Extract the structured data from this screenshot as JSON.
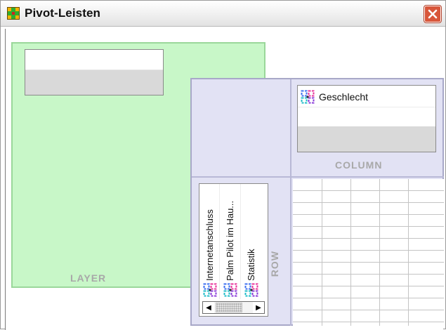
{
  "window": {
    "title": "Pivot-Leisten",
    "title_icon": "pivot-trays-icon",
    "close_icon": "close-x-icon"
  },
  "layer": {
    "label": "LAYER",
    "color": "#c8f7c8"
  },
  "column": {
    "label": "COLUMN",
    "items": [
      {
        "label": "Geschlecht",
        "icon": "nominal-variable-icon"
      }
    ]
  },
  "row": {
    "label": "ROW",
    "items": [
      {
        "label": "Internetanschluss",
        "icon": "nominal-variable-icon"
      },
      {
        "label": "Palm Pilot im Hau...",
        "icon": "nominal-variable-icon"
      },
      {
        "label": "Statistik",
        "icon": "nominal-variable-icon"
      }
    ],
    "scroll_left_icon": "scroll-left-arrow-icon",
    "scroll_right_icon": "scroll-right-arrow-icon"
  },
  "colors": {
    "pivot_panel": "#e2e2f4",
    "close_button": "#d8563a"
  }
}
